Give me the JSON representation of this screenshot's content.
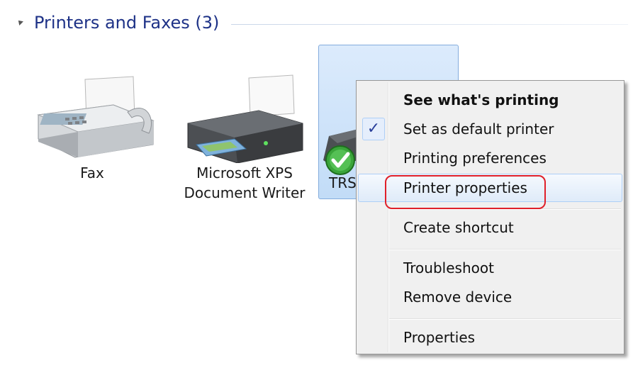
{
  "group": {
    "title": "Printers and Faxes (3)"
  },
  "devices": [
    {
      "label": "Fax",
      "icon": "fax-machine-icon"
    },
    {
      "label_line1": "Microsoft XPS",
      "label_line2": "Document Writer",
      "icon": "printer-icon"
    },
    {
      "label": "TRS",
      "icon": "printer-icon",
      "default": true,
      "selected": true
    }
  ],
  "context_menu": {
    "items": [
      {
        "label": "See what's printing",
        "bold": true
      },
      {
        "label": "Set as default printer",
        "checked": true
      },
      {
        "label": "Printing preferences"
      },
      {
        "label": "Printer properties",
        "hovered": true
      },
      {
        "label": "Create shortcut"
      },
      {
        "label": "Troubleshoot"
      },
      {
        "label": "Remove device"
      },
      {
        "label": "Properties"
      }
    ],
    "check_glyph": "✓"
  },
  "colors": {
    "group_title": "#1e3287",
    "selection_bg": "#c2dcf7",
    "annotation_ring": "#e0202a"
  }
}
